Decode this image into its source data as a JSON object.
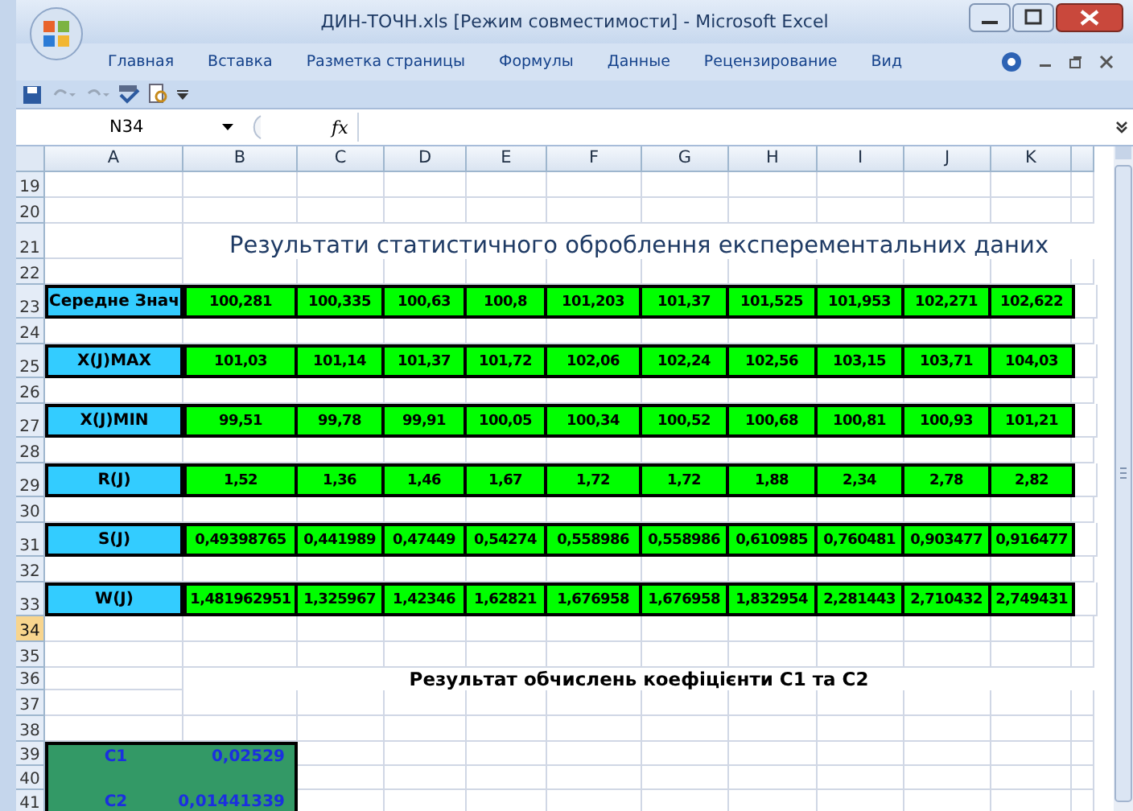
{
  "window": {
    "title": "ДИН-ТОЧН.xls  [Режим совместимости] - Microsoft Excel"
  },
  "tabs": [
    {
      "label": "Главная",
      "selected": false
    },
    {
      "label": "Вставка",
      "selected": false
    },
    {
      "label": "Разметка страницы",
      "selected": false
    },
    {
      "label": "Формулы",
      "selected": false
    },
    {
      "label": "Данные",
      "selected": false
    },
    {
      "label": "Рецензирование",
      "selected": false
    },
    {
      "label": "Вид",
      "selected": false
    }
  ],
  "formula_bar": {
    "name_box": "N34",
    "function_label": "fx"
  },
  "columns": [
    "A",
    "B",
    "C",
    "D",
    "E",
    "F",
    "G",
    "H",
    "I",
    "J",
    "K"
  ],
  "rows": [
    {
      "number": "19",
      "selected": false,
      "kind": "blank"
    },
    {
      "number": "20",
      "selected": false,
      "kind": "blank"
    },
    {
      "number": "21",
      "selected": false,
      "kind": "title",
      "text": "Результати статистичного оброблення експерементальних даних"
    },
    {
      "number": "22",
      "selected": false,
      "kind": "blank"
    },
    {
      "number": "23",
      "selected": false,
      "kind": "data",
      "label": "Середне Знач",
      "values": [
        "100,281",
        "100,335",
        "100,63",
        "100,8",
        "101,203",
        "101,37",
        "101,525",
        "101,953",
        "102,271",
        "102,622"
      ]
    },
    {
      "number": "24",
      "selected": false,
      "kind": "blank"
    },
    {
      "number": "25",
      "selected": false,
      "kind": "data",
      "label": "X(J)MAX",
      "values": [
        "101,03",
        "101,14",
        "101,37",
        "101,72",
        "102,06",
        "102,24",
        "102,56",
        "103,15",
        "103,71",
        "104,03"
      ]
    },
    {
      "number": "26",
      "selected": false,
      "kind": "blank"
    },
    {
      "number": "27",
      "selected": false,
      "kind": "data",
      "label": "X(J)MIN",
      "values": [
        "99,51",
        "99,78",
        "99,91",
        "100,05",
        "100,34",
        "100,52",
        "100,68",
        "100,81",
        "100,93",
        "101,21"
      ]
    },
    {
      "number": "28",
      "selected": false,
      "kind": "blank"
    },
    {
      "number": "29",
      "selected": false,
      "kind": "data",
      "label": "R(J)",
      "values": [
        "1,52",
        "1,36",
        "1,46",
        "1,67",
        "1,72",
        "1,72",
        "1,88",
        "2,34",
        "2,78",
        "2,82"
      ]
    },
    {
      "number": "30",
      "selected": false,
      "kind": "blank"
    },
    {
      "number": "31",
      "selected": false,
      "kind": "data",
      "label": "S(J)",
      "values": [
        "0,49398765",
        "0,441989",
        "0,47449",
        "0,54274",
        "0,558986",
        "0,558986",
        "0,610985",
        "0,760481",
        "0,903477",
        "0,916477"
      ]
    },
    {
      "number": "32",
      "selected": false,
      "kind": "blank"
    },
    {
      "number": "33",
      "selected": false,
      "kind": "data",
      "label": "W(J)",
      "values": [
        "1,481962951",
        "1,325967",
        "1,42346",
        "1,62821",
        "1,676958",
        "1,676958",
        "1,832954",
        "2,281443",
        "2,710432",
        "2,749431"
      ]
    },
    {
      "number": "34",
      "selected": true,
      "kind": "blank"
    },
    {
      "number": "35",
      "selected": false,
      "kind": "blank"
    },
    {
      "number": "36",
      "selected": false,
      "kind": "heading",
      "text": "Результат обчислень коефіцієнти C1 та C2"
    },
    {
      "number": "37",
      "selected": false,
      "kind": "blank"
    },
    {
      "number": "38",
      "selected": false,
      "kind": "blank"
    },
    {
      "number": "39",
      "selected": false,
      "kind": "coef",
      "label": "C1",
      "value": "0,02529"
    },
    {
      "number": "40",
      "selected": false,
      "kind": "coef_gap"
    },
    {
      "number": "41",
      "selected": false,
      "kind": "coef",
      "label": "C2",
      "value": "0,01441339"
    }
  ]
}
